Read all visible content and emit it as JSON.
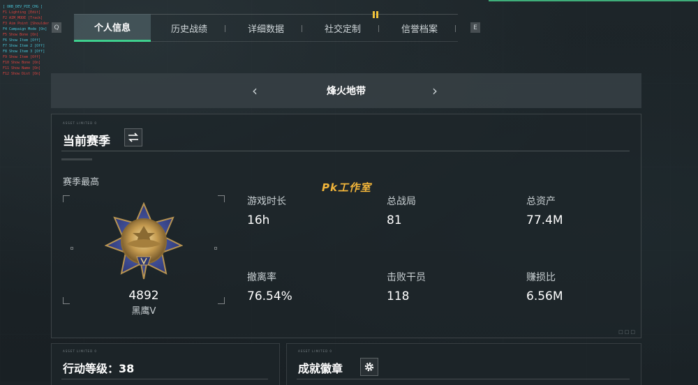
{
  "debug_lines": [
    {
      "text": "[ ORB_DEV_PIE_CHG ]",
      "color": "#49c5d8"
    },
    {
      "text": "F1 Lighting [Edit]",
      "color": "#e0433f"
    },
    {
      "text": "F2 AIM_MODE [Track]",
      "color": "#e0433f"
    },
    {
      "text": "F3 Aim Point [Shoulder]",
      "color": "#e0433f"
    },
    {
      "text": "F4 Campaign Mode [On]",
      "color": "#49c5d8"
    },
    {
      "text": "F5 Show Bone [On]",
      "color": "#e0433f"
    },
    {
      "text": "F6 Show Item [Off]",
      "color": "#49c5d8"
    },
    {
      "text": "F7 Show Item 2 [Off]",
      "color": "#49c5d8"
    },
    {
      "text": "F8 Show Item 3 [Off]",
      "color": "#49c5d8"
    },
    {
      "text": "F9 Show Item [Off]",
      "color": "#e0433f"
    },
    {
      "text": "F10 Show Bone [On]",
      "color": "#e0433f"
    },
    {
      "text": "F11 Show Name [On]",
      "color": "#e0433f"
    },
    {
      "text": "F12 Show Dist [On]",
      "color": "#e0433f"
    }
  ],
  "tabs": {
    "left_key": "Q",
    "right_key": "E",
    "items": [
      "个人信息",
      "历史战绩",
      "详细数据",
      "社交定制",
      "信誉档案"
    ],
    "active_index": 0
  },
  "mode": {
    "title": "烽火地带",
    "prev": "‹",
    "next": "›"
  },
  "watermark": "Pk工作室",
  "season": {
    "tag": "ASSET LIMITED 0",
    "title": "当前赛季",
    "best_label": "赛季最高",
    "rank_score": "4892",
    "rank_name": "黑鹰V",
    "corner_mark": "□□□",
    "stats": [
      {
        "label": "游戏时长",
        "value": "16h"
      },
      {
        "label": "总战局",
        "value": "81"
      },
      {
        "label": "总资产",
        "value": "77.4M"
      },
      {
        "label": "撤离率",
        "value": "76.54%"
      },
      {
        "label": "击败干员",
        "value": "118"
      },
      {
        "label": "赚损比",
        "value": "6.56M"
      }
    ]
  },
  "action_level": {
    "tag": "ASSET LIMITED 0",
    "title": "行动等级：38"
  },
  "achievements": {
    "tag": "ASSET LIMITED 0",
    "title": "成就徽章"
  },
  "colors": {
    "accent": "#3fcf8e",
    "watermark": "#f2b53a",
    "pause": "#f0c23a"
  },
  "icons": {
    "swap": "swap-icon",
    "gear": "gear-icon",
    "pause": "pause-icon"
  }
}
